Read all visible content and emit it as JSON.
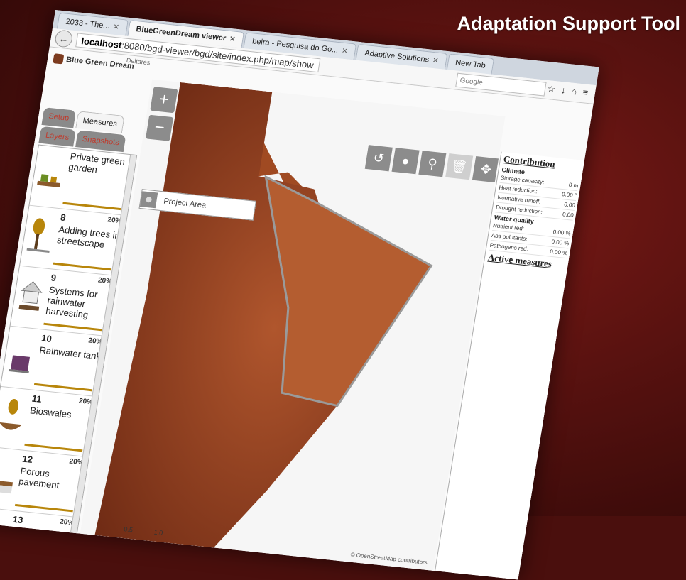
{
  "overlay_title": "Adaptation Support Tool",
  "browser": {
    "tabs": [
      {
        "label": "2033 - The...",
        "active": false
      },
      {
        "label": "BlueGreenDream viewer",
        "active": true
      },
      {
        "label": "beira - Pesquisa do Go...",
        "active": false
      },
      {
        "label": "Adaptive Solutions",
        "active": false
      },
      {
        "label": "New Tab",
        "active": false
      }
    ],
    "url_host": "localhost",
    "url_rest": ":8080/bgd-viewer/bgd/site/index.php/map/show",
    "search_placeholder": "Google"
  },
  "app": {
    "logo_text": "Blue Green Dream",
    "deltares": "Deltares",
    "sidebar_tabs": {
      "setup": "Setup",
      "measures": "Measures",
      "layers": "Layers",
      "snapshots": "Snapshots"
    },
    "measures": [
      {
        "num": "",
        "pct": "",
        "name": "Private green garden"
      },
      {
        "num": "8",
        "pct": "20%",
        "name": "Adding trees in streetscape"
      },
      {
        "num": "9",
        "pct": "20%",
        "name": "Systems for rainwater harvesting"
      },
      {
        "num": "10",
        "pct": "20%",
        "name": "Rainwater tank"
      },
      {
        "num": "11",
        "pct": "20%",
        "name": "Bioswales"
      },
      {
        "num": "12",
        "pct": "20%",
        "name": "Porous pavement"
      },
      {
        "num": "13",
        "pct": "20%",
        "name": ""
      }
    ],
    "map": {
      "zoom_in": "+",
      "zoom_out": "−",
      "project_area": "Project Area",
      "attribution": "© OpenStreetMap contributors",
      "scale_labels": [
        "0.5",
        "1.0"
      ]
    },
    "contribution": {
      "title": "Contribution",
      "climate_label": "Climate",
      "climate_rows": [
        {
          "label": "Storage capacity:",
          "value": "0 m"
        },
        {
          "label": "Heat reduction:",
          "value": "0.00 °"
        },
        {
          "label": "Normative runoff:",
          "value": "0.00"
        },
        {
          "label": "Drought reduction:",
          "value": "0.00"
        }
      ],
      "water_quality_label": "Water quality",
      "wq_rows": [
        {
          "label": "Nutrient red:",
          "value": "0.00 %"
        },
        {
          "label": "Abs polutants:",
          "value": "0.00 %"
        },
        {
          "label": "Pathogens red:",
          "value": "0.00 %"
        }
      ],
      "active_measures": "Active measures"
    }
  }
}
